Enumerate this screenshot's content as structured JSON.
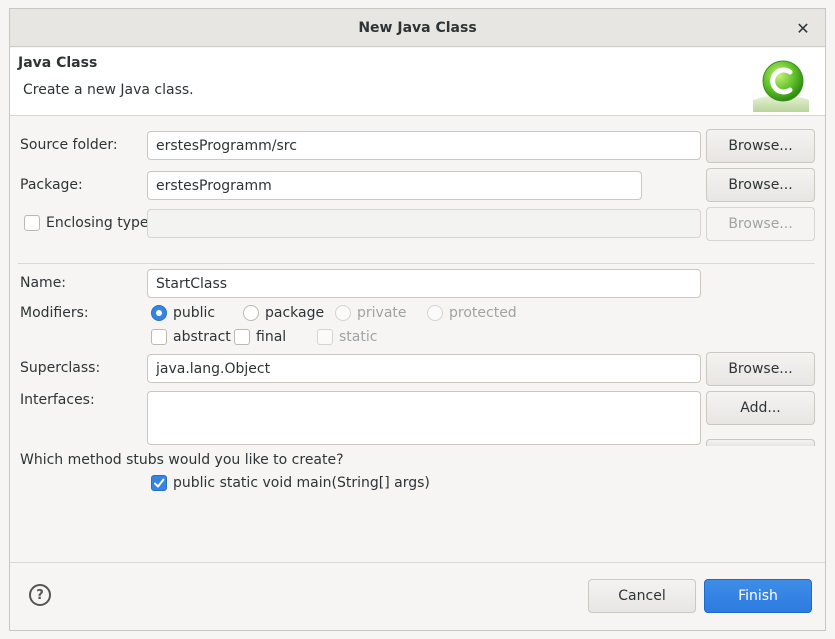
{
  "window": {
    "title": "New Java Class",
    "accent": "#3584e4"
  },
  "banner": {
    "heading": "Java Class",
    "description": "Create a new Java class.",
    "icon": "java-class-c-icon"
  },
  "source_folder": {
    "label": "Source folder:",
    "value": "erstesProgramm/src",
    "browse": "Browse..."
  },
  "package": {
    "label": "Package:",
    "value": "erstesProgramm",
    "browse": "Browse..."
  },
  "enclosing": {
    "label": "Enclosing type:",
    "value": "",
    "browse": "Browse...",
    "checked": false
  },
  "name": {
    "label": "Name:",
    "value": "StartClass"
  },
  "modifiers": {
    "label": "Modifiers:",
    "access": [
      "public",
      "package",
      "private",
      "protected"
    ],
    "selected": "public",
    "flags": [
      "abstract",
      "final",
      "static"
    ]
  },
  "superclass": {
    "label": "Superclass:",
    "value": "java.lang.Object",
    "browse": "Browse..."
  },
  "interfaces": {
    "label": "Interfaces:",
    "add": "Add..."
  },
  "stubs": {
    "question": "Which method stubs would you like to create?",
    "main": "public static void main(String[] args)",
    "main_checked": true
  },
  "footer": {
    "help": "?",
    "cancel": "Cancel",
    "finish": "Finish"
  }
}
